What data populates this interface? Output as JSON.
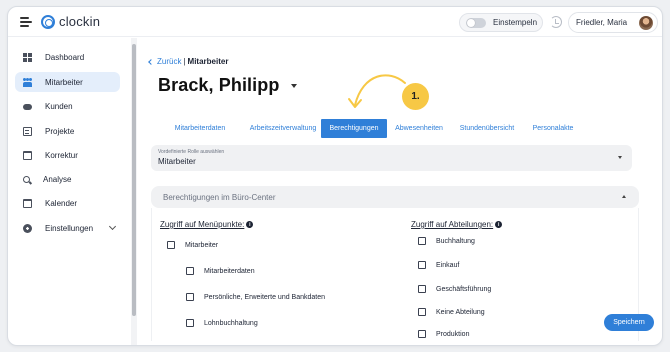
{
  "app": {
    "logo_text": "clockin",
    "clockin_label": "Einstempeln",
    "user_name": "Friedler, Maria"
  },
  "sidebar": {
    "items": [
      {
        "label": "Dashboard",
        "icon": "dashboard-icon",
        "active": false
      },
      {
        "label": "Mitarbeiter",
        "icon": "users-icon",
        "active": true
      },
      {
        "label": "Kunden",
        "icon": "handshake-icon",
        "active": false
      },
      {
        "label": "Projekte",
        "icon": "list-icon",
        "active": false
      },
      {
        "label": "Korrektur",
        "icon": "calendar-edit-icon",
        "active": false
      },
      {
        "label": "Analyse",
        "icon": "search-icon",
        "active": false
      },
      {
        "label": "Kalender",
        "icon": "calendar-icon",
        "active": false
      },
      {
        "label": "Einstellungen",
        "icon": "gear-icon",
        "active": false
      }
    ]
  },
  "breadcrumb": {
    "back_label": "Zurück",
    "separator": "|",
    "current": "Mitarbeiter"
  },
  "employee": {
    "name": "Brack, Philipp"
  },
  "annotation": {
    "step_label": "1."
  },
  "tabs": [
    {
      "label": "Mitarbeiterdaten",
      "active": false
    },
    {
      "label": "Arbeitszeitverwaltung",
      "active": false
    },
    {
      "label": "Berechtigungen",
      "active": true
    },
    {
      "label": "Abwesenheiten",
      "active": false
    },
    {
      "label": "Stundenübersicht",
      "active": false
    },
    {
      "label": "Personalakte",
      "active": false
    }
  ],
  "role_select": {
    "caption": "Vordefinierte Rolle auswählen",
    "value": "Mitarbeiter"
  },
  "permissions": {
    "section_title": "Berechtigungen im Büro-Center",
    "menu_heading": "Zugriff auf Menüpunkte:",
    "menu_items": [
      {
        "label": "Mitarbeiter",
        "level": 0,
        "checked": false
      },
      {
        "label": "Mitarbeiterdaten",
        "level": 1,
        "checked": false
      },
      {
        "label": "Persönliche, Erweiterte und Bankdaten",
        "level": 1,
        "checked": false
      },
      {
        "label": "Lohnbuchhaltung",
        "level": 1,
        "checked": false
      }
    ],
    "dept_heading": "Zugriff auf Abteilungen:",
    "departments": [
      {
        "label": "Buchhaltung",
        "checked": false
      },
      {
        "label": "Einkauf",
        "checked": false
      },
      {
        "label": "Geschäftsführung",
        "checked": false
      },
      {
        "label": "Keine Abteilung",
        "checked": false
      },
      {
        "label": "Produktion",
        "checked": false
      }
    ]
  },
  "actions": {
    "save_label": "Speichern"
  },
  "colors": {
    "accent": "#2f7fd8",
    "annotation": "#f7c845",
    "active_nav_bg": "#e4eefb"
  }
}
